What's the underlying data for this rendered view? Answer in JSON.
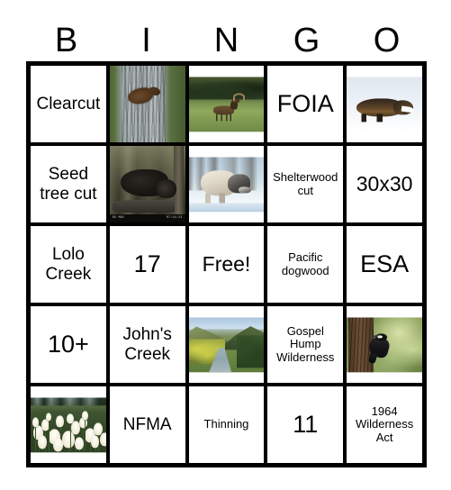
{
  "header": {
    "letters": [
      "B",
      "I",
      "N",
      "G",
      "O"
    ]
  },
  "grid": {
    "rows": 5,
    "columns": 5,
    "cells": [
      {
        "id": "b1",
        "type": "text",
        "text": "Clearcut",
        "size": "t-md"
      },
      {
        "id": "i1",
        "type": "image",
        "image": "pine-marten-on-tree-trunk",
        "alt": "Pine marten climbing a tree trunk"
      },
      {
        "id": "n1",
        "type": "image",
        "image": "elk-in-meadow",
        "alt": "Bull elk standing in a forest meadow"
      },
      {
        "id": "g1",
        "type": "text",
        "text": "FOIA",
        "size": "t-xl"
      },
      {
        "id": "o1",
        "type": "image",
        "image": "wolverine-on-snow",
        "alt": "Wolverine walking across snow"
      },
      {
        "id": "b2",
        "type": "text",
        "text": "Seed tree cut",
        "size": "t-md"
      },
      {
        "id": "i2",
        "type": "image",
        "image": "black-bear-trail-camera",
        "alt": "Black bear photographed by trail camera",
        "stamp_left": "05 MAY",
        "stamp_right": "07:14:22"
      },
      {
        "id": "n2",
        "type": "image",
        "image": "gray-wolf-in-snow",
        "alt": "Gray wolf walking in snow"
      },
      {
        "id": "g2",
        "type": "text",
        "text": "Shelterwood cut",
        "size": "t-sm"
      },
      {
        "id": "o2",
        "type": "text",
        "text": "30x30",
        "size": "t-lg"
      },
      {
        "id": "b3",
        "type": "text",
        "text": "Lolo Creek",
        "size": "t-md"
      },
      {
        "id": "i3",
        "type": "text",
        "text": "17",
        "size": "t-xl"
      },
      {
        "id": "n3",
        "type": "text",
        "text": "Free!",
        "size": "t-lg",
        "free": true
      },
      {
        "id": "g3",
        "type": "text",
        "text": "Pacific dogwood",
        "size": "t-sm"
      },
      {
        "id": "o3",
        "type": "text",
        "text": "ESA",
        "size": "t-xl"
      },
      {
        "id": "b4",
        "type": "text",
        "text": "10+",
        "size": "t-xl"
      },
      {
        "id": "i4",
        "type": "text",
        "text": "John's Creek",
        "size": "t-md"
      },
      {
        "id": "n4",
        "type": "image",
        "image": "river-canyon-autumn",
        "alt": "River canyon with autumn foliage"
      },
      {
        "id": "g4",
        "type": "text",
        "text": "Gospel Hump Wilderness",
        "size": "t-sm"
      },
      {
        "id": "o4",
        "type": "image",
        "image": "black-backed-woodpecker",
        "alt": "Black-backed woodpecker on a burned tree"
      },
      {
        "id": "b5",
        "type": "image",
        "image": "beargrass-blooms",
        "alt": "Beargrass blooming in a forest clearing"
      },
      {
        "id": "i5",
        "type": "text",
        "text": "NFMA",
        "size": "t-md"
      },
      {
        "id": "n5",
        "type": "text",
        "text": "Thinning",
        "size": "t-sm"
      },
      {
        "id": "g5",
        "type": "text",
        "text": "11",
        "size": "t-xl"
      },
      {
        "id": "o5",
        "type": "text",
        "text": "1964 Wilderness Act",
        "size": "t-sm"
      }
    ]
  },
  "colors": {
    "border": "#000000",
    "background": "#ffffff",
    "text": "#000000"
  }
}
